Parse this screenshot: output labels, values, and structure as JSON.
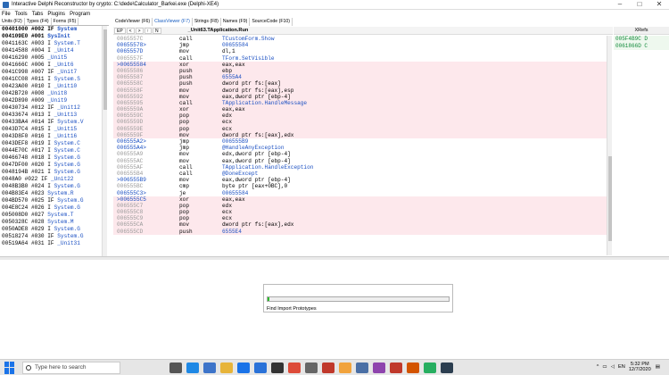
{
  "window": {
    "title": "Interactive Delphi Reconstructor by crypto: C:\\dede\\Calculator_Barkei.exe (Delphi-XE4)"
  },
  "menu": [
    "File",
    "Tools",
    "Tabs",
    "Plugins",
    "Program"
  ],
  "left_tabs": [
    "Units (F2)",
    "Types (F4)",
    "Forms (F5)"
  ],
  "main_tabs": [
    {
      "label": "CodeViewer (F6)",
      "active": false
    },
    {
      "label": "ClassViewer (F7)",
      "active": true
    },
    {
      "label": "Strings (F8)",
      "active": false
    },
    {
      "label": "Names (F9)",
      "active": false
    },
    {
      "label": "SourceCode (F10)",
      "active": false
    }
  ],
  "code_toolbar": {
    "buttons": [
      "EP",
      "<",
      ">",
      "↑",
      "N"
    ],
    "function_name": "_Unit63.TApplication.Run"
  },
  "units": [
    {
      "addr": "00401000",
      "num": "#002",
      "flag": "IF",
      "name": "System",
      "bold": true
    },
    {
      "addr": "004109E0",
      "num": "#001",
      "flag": "",
      "name": "SysInit",
      "bold": true
    },
    {
      "addr": "0041163C",
      "num": "#003",
      "flag": "I",
      "name": "System.T"
    },
    {
      "addr": "00414588",
      "num": "#004",
      "flag": "I",
      "name": "_Unit4"
    },
    {
      "addr": "00416290",
      "num": "#005",
      "flag": "",
      "name": "_Unit5"
    },
    {
      "addr": "0041666C",
      "num": "#006",
      "flag": "I",
      "name": "_Unit6"
    },
    {
      "addr": "0041C998",
      "num": "#007",
      "flag": "IF",
      "name": "_Unit7"
    },
    {
      "addr": "0041CC08",
      "num": "#011",
      "flag": "I",
      "name": "System.S"
    },
    {
      "addr": "00423A00",
      "num": "#010",
      "flag": "I",
      "name": "_Unit10"
    },
    {
      "addr": "0042B720",
      "num": "#008",
      "flag": "",
      "name": "_Unit8"
    },
    {
      "addr": "0042D890",
      "num": "#009",
      "flag": "",
      "name": "_Unit9"
    },
    {
      "addr": "00430734",
      "num": "#012",
      "flag": "IF",
      "name": "_Unit12"
    },
    {
      "addr": "00433674",
      "num": "#013",
      "flag": "I",
      "name": "_Unit13"
    },
    {
      "addr": "00433BA4",
      "num": "#014",
      "flag": "IF",
      "name": "System.V"
    },
    {
      "addr": "0043D7C4",
      "num": "#015",
      "flag": "I",
      "name": "_Unit15"
    },
    {
      "addr": "0043D8F0",
      "num": "#016",
      "flag": "I",
      "name": "_Unit16"
    },
    {
      "addr": "0043DEF8",
      "num": "#019",
      "flag": "I",
      "name": "System.C"
    },
    {
      "addr": "0044E70C",
      "num": "#017",
      "flag": "I",
      "name": "System.C"
    },
    {
      "addr": "00466748",
      "num": "#018",
      "flag": "I",
      "name": "System.G"
    },
    {
      "addr": "0047DF00",
      "num": "#020",
      "flag": "I",
      "name": "System.G"
    },
    {
      "addr": "0048194B",
      "num": "#021",
      "flag": "I",
      "name": "System.G"
    },
    {
      "addr": "0048A0",
      "num": "#022",
      "flag": "IF",
      "name": "_Unit22"
    },
    {
      "addr": "0048B3B0",
      "num": "#024",
      "flag": "I",
      "name": "System.G"
    },
    {
      "addr": "004B83E4",
      "num": "#023",
      "flag": "",
      "name": "System.R"
    },
    {
      "addr": "004BD570",
      "num": "#025",
      "flag": "IF",
      "name": "System.G"
    },
    {
      "addr": "004E8C24",
      "num": "#026",
      "flag": "I",
      "name": "System.G"
    },
    {
      "addr": "005008D0",
      "num": "#027",
      "flag": "",
      "name": "System.T"
    },
    {
      "addr": "0050328C",
      "num": "#028",
      "flag": "",
      "name": "System.M"
    },
    {
      "addr": "0050ADE8",
      "num": "#029",
      "flag": "I",
      "name": "System.G"
    },
    {
      "addr": "00518274",
      "num": "#030",
      "flag": "IF",
      "name": "System.G"
    },
    {
      "addr": "00519A64",
      "num": "#031",
      "flag": "IF",
      "name": "_Unit31"
    }
  ],
  "code": [
    {
      "addr": "0065557C",
      "hot": false,
      "pink": false,
      "mnem": "call",
      "ops": "TCustomForm.Show",
      "call": true
    },
    {
      "addr": "00655578>",
      "hot": true,
      "pink": false,
      "mnem": "jmp",
      "ops": "00655584",
      "call": true
    },
    {
      "addr": "0065557D",
      "hot": true,
      "pink": false,
      "mnem": "mov",
      "ops": "dl,1",
      "call": false
    },
    {
      "addr": "0065557F",
      "hot": false,
      "pink": false,
      "mnem": "call",
      "ops": "TForm.SetVisible",
      "call": true
    },
    {
      "addr": ">00655584",
      "hot": true,
      "pink": true,
      "mnem": "xor",
      "ops": "eax,eax",
      "call": false
    },
    {
      "addr": "00655586",
      "hot": false,
      "pink": true,
      "mnem": "push",
      "ops": "ebp",
      "call": false
    },
    {
      "addr": "00655587",
      "hot": false,
      "pink": true,
      "mnem": "push",
      "ops": "6555A4",
      "call": true
    },
    {
      "addr": "0065558C",
      "hot": false,
      "pink": true,
      "mnem": "push",
      "ops": "dword ptr fs:[eax]",
      "call": false
    },
    {
      "addr": "0065558F",
      "hot": false,
      "pink": true,
      "mnem": "mov",
      "ops": "dword ptr fs:[eax],esp",
      "call": false
    },
    {
      "addr": "00655592",
      "hot": false,
      "pink": true,
      "mnem": "mov",
      "ops": "eax,dword ptr [ebp-4]",
      "call": false
    },
    {
      "addr": "00655595",
      "hot": false,
      "pink": true,
      "mnem": "call",
      "ops": "TApplication.HandleMessage",
      "call": true
    },
    {
      "addr": "0065559A",
      "hot": false,
      "pink": true,
      "mnem": "xor",
      "ops": "eax,eax",
      "call": false
    },
    {
      "addr": "0065559C",
      "hot": false,
      "pink": true,
      "mnem": "pop",
      "ops": "edx",
      "call": false
    },
    {
      "addr": "0065559D",
      "hot": false,
      "pink": true,
      "mnem": "pop",
      "ops": "ecx",
      "call": false
    },
    {
      "addr": "0065559E",
      "hot": false,
      "pink": true,
      "mnem": "pop",
      "ops": "ecx",
      "call": false
    },
    {
      "addr": "0065559F",
      "hot": false,
      "pink": true,
      "mnem": "mov",
      "ops": "dword ptr fs:[eax],edx",
      "call": false
    },
    {
      "addr": "006555A2>",
      "hot": true,
      "pink": false,
      "mnem": "jmp",
      "ops": "006555B9",
      "call": true
    },
    {
      "addr": "006555A4>",
      "hot": true,
      "pink": false,
      "mnem": "jmp",
      "ops": "@HandleAnyException",
      "call": true
    },
    {
      "addr": "006555A9",
      "hot": false,
      "pink": false,
      "mnem": "mov",
      "ops": "edx,dword ptr [ebp-4]",
      "call": false
    },
    {
      "addr": "006555AC",
      "hot": false,
      "pink": false,
      "mnem": "mov",
      "ops": "eax,dword ptr [ebp-4]",
      "call": false
    },
    {
      "addr": "006555AF",
      "hot": false,
      "pink": false,
      "mnem": "call",
      "ops": "TApplication.HandleException",
      "call": true
    },
    {
      "addr": "006555B4",
      "hot": false,
      "pink": false,
      "mnem": "call",
      "ops": "@DoneExcept",
      "call": true
    },
    {
      "addr": ">006555B9",
      "hot": true,
      "pink": false,
      "mnem": "mov",
      "ops": "eax,dword ptr [ebp-4]",
      "call": false
    },
    {
      "addr": "006555BC",
      "hot": false,
      "pink": false,
      "mnem": "cmp",
      "ops": "byte ptr [eax+0BC],0",
      "call": false
    },
    {
      "addr": "006555C3>",
      "hot": true,
      "pink": false,
      "mnem": "je",
      "ops": "00655584",
      "call": true
    },
    {
      "addr": ">006555C5",
      "hot": true,
      "pink": true,
      "mnem": "xor",
      "ops": "eax,eax",
      "call": false
    },
    {
      "addr": "006555C7",
      "hot": false,
      "pink": true,
      "mnem": "pop",
      "ops": "edx",
      "call": false
    },
    {
      "addr": "006555C8",
      "hot": false,
      "pink": true,
      "mnem": "pop",
      "ops": "ecx",
      "call": false
    },
    {
      "addr": "006555C9",
      "hot": false,
      "pink": true,
      "mnem": "pop",
      "ops": "ecx",
      "call": false
    },
    {
      "addr": "006555CA",
      "hot": false,
      "pink": true,
      "mnem": "mov",
      "ops": "dword ptr fs:[eax],edx",
      "call": false
    },
    {
      "addr": "006555CD",
      "hot": false,
      "pink": true,
      "mnem": "push",
      "ops": "6555E4",
      "call": true
    }
  ],
  "xrefs": {
    "header": "XRefs",
    "items": [
      "005F4B9C D",
      "0061866D C"
    ]
  },
  "progress": {
    "label": "Find Import Prototypes",
    "value": 0.01
  },
  "taskbar": {
    "search_placeholder": "Type here to search",
    "time": "5:32 PM",
    "date": "12/7/2020"
  }
}
